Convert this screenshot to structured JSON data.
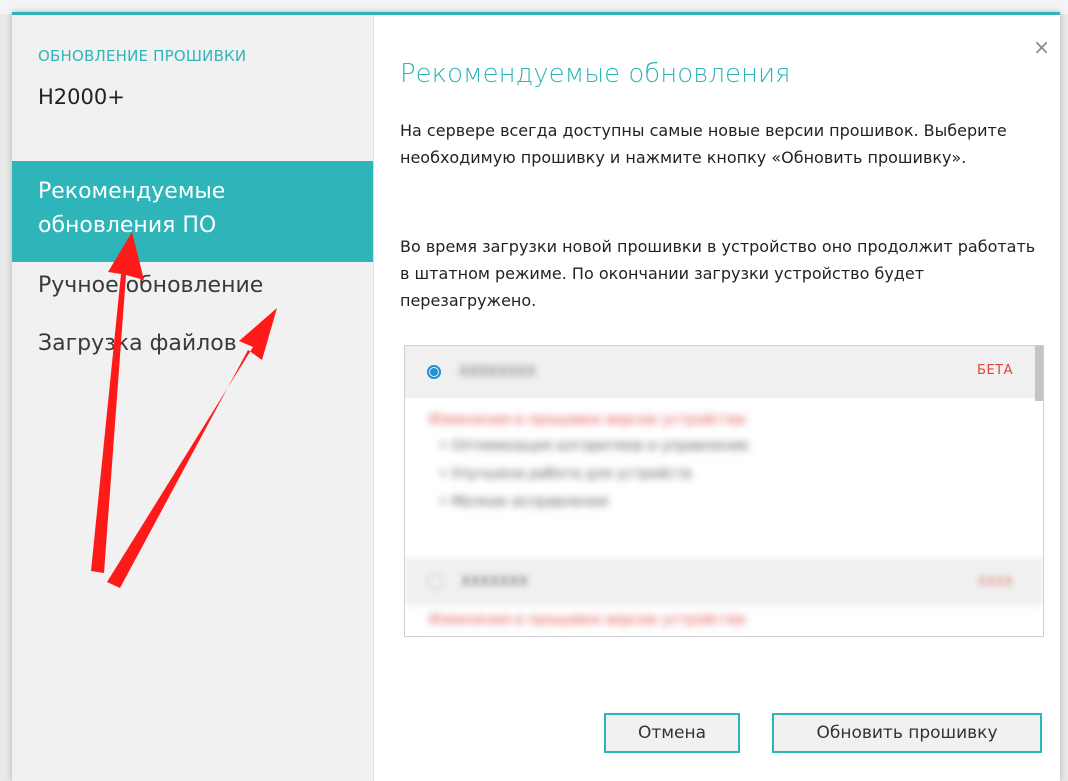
{
  "dialog": {
    "sidebar": {
      "heading": "ОБНОВЛЕНИЕ ПРОШИВКИ",
      "device": "H2000+",
      "nav": [
        {
          "label": "Рекомендуемые обновления ПО",
          "active": true
        },
        {
          "label": "Ручное обновление",
          "active": false
        },
        {
          "label": "Загрузка файлов",
          "active": false
        }
      ]
    },
    "main": {
      "close_glyph": "×",
      "title": "Рекомендуемые обновления",
      "paragraph1": "На сервере всегда доступны самые новые версии прошивок. Выберите необходимую прошивку и нажмите кнопку «Обновить прошивку».",
      "paragraph2": "Во время загрузки новой прошивки в устройство оно продолжит работать в штатном режиме. По окончании загрузки устройство будет перезагружено.",
      "firmware_list": {
        "selected_item": {
          "version": "XXXXXXXX",
          "badge": "БЕТА",
          "note": "Изменения в прошивке версии устройства",
          "bullets": [
            "Оптимизация алгоритмов и управление",
            "Улучшена работа для устройств",
            "Мелкие исправления"
          ]
        },
        "second_item": {
          "version": "XXXXXXX",
          "badge": "XXXX",
          "note": "Изменения в прошивке версии устройства"
        }
      },
      "buttons": {
        "cancel": "Отмена",
        "update": "Обновить прошивку"
      }
    }
  },
  "colors": {
    "accent": "#2db5b9",
    "beta_badge": "#d9483b",
    "radio": "#1e90d6",
    "annotation_arrow": "#ff1a1a"
  }
}
